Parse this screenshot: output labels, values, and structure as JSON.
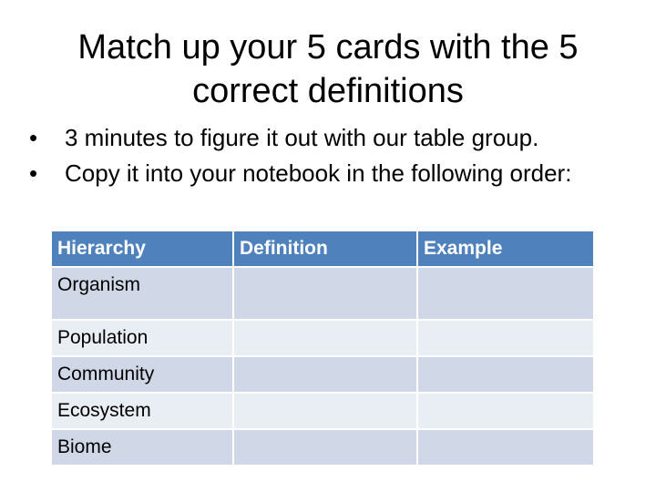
{
  "slide": {
    "title_lines": [
      "Match up your 5 cards with the 5",
      "correct definitions"
    ],
    "bullets": [
      "3 minutes to figure it out with our table group.",
      "Copy it into your notebook in the following order:"
    ],
    "bullet_glyph": "•",
    "table": {
      "headers": [
        "Hierarchy",
        "Definition",
        "Example"
      ],
      "rows": [
        [
          "Organism",
          "",
          ""
        ],
        [
          "Population",
          "",
          ""
        ],
        [
          "Community",
          "",
          ""
        ],
        [
          "Ecosystem",
          "",
          ""
        ],
        [
          "Biome",
          "",
          ""
        ]
      ],
      "header_color": "#4f81bd",
      "row_dark_color": "#d0d8e8",
      "row_light_color": "#e9edf4"
    }
  }
}
